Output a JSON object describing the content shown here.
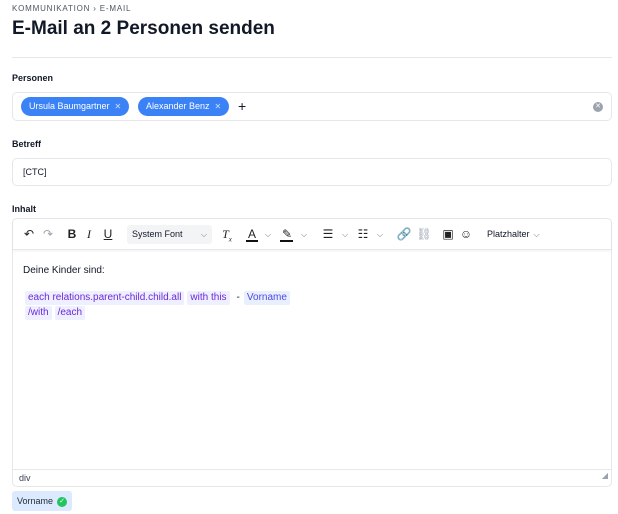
{
  "header": {
    "breadcrumb": "KOMMUNIKATION › E-MAIL",
    "title": "E-Mail an 2 Personen senden"
  },
  "persons": {
    "label": "Personen",
    "chips": [
      "Ursula Baumgartner",
      "Alexander Benz"
    ],
    "add_symbol": "+"
  },
  "subject": {
    "label": "Betreff",
    "value": "[CTC]"
  },
  "content": {
    "label": "Inhalt",
    "toolbar": {
      "font": "System Font",
      "placeholder": "Platzhalter"
    },
    "body_line": "Deine Kinder sind:",
    "tokens_line1": [
      "each relations.parent-child.child.all",
      "with this"
    ],
    "dash": "-",
    "field_token": "Vorname",
    "tokens_line2": [
      "/with",
      "/each"
    ],
    "status_path": "div"
  },
  "variables": {
    "chip": "Vorname"
  },
  "colors": {
    "chip_blue": "#3b82f6",
    "token_purple": "#6d28d9",
    "check_green": "#22c55e"
  }
}
